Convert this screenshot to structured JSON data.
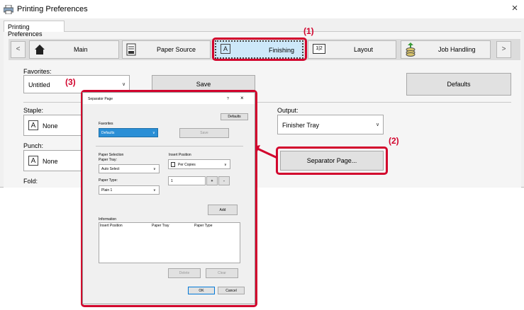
{
  "window": {
    "title": "Printing Preferences",
    "close": "×"
  },
  "tab": {
    "label": "Printing Preferences"
  },
  "nav": {
    "prev": "<",
    "next": ">",
    "main": "Main",
    "paper_source": "Paper Source",
    "finishing": "Finishing",
    "layout": "Layout",
    "layout_icon_text": "1|2",
    "job_handling": "Job Handling"
  },
  "favorites": {
    "label": "Favorites:",
    "value": "Untitled",
    "save": "Save",
    "defaults": "Defaults"
  },
  "staple": {
    "label": "Staple:",
    "value": "None"
  },
  "punch": {
    "label": "Punch:",
    "value": "None"
  },
  "fold": {
    "label": "Fold:"
  },
  "output": {
    "label": "Output:",
    "value": "Finisher Tray"
  },
  "separator_button": "Separator Page...",
  "callouts": {
    "c1": "(1)",
    "c2": "(2)",
    "c3": "(3)"
  },
  "dialog": {
    "title": "Separator Page",
    "help": "?",
    "close": "×",
    "defaults": "Defaults",
    "favorites_label": "Favorites",
    "favorites_value": "Defaults",
    "save": "Save",
    "paper_selection": "Paper Selection",
    "paper_tray_label": "Paper Tray:",
    "paper_tray_value": "Auto Select",
    "paper_type_label": "Paper Type:",
    "paper_type_value": "Plain 1",
    "insert_position_label": "Insert Position",
    "insert_position_value": "Per Copies",
    "count_value": "1",
    "plus": "+",
    "minus": "-",
    "add": "Add",
    "information": "Information",
    "col_insert": "Insert Position",
    "col_tray": "Paper Tray",
    "col_type": "Paper Type",
    "delete": "Delete",
    "clear": "Clear",
    "ok": "OK",
    "cancel": "Cancel"
  },
  "colors": {
    "highlight": "#d2042d",
    "active_tab": "#cde8f9",
    "selected": "#2b8fd6"
  }
}
